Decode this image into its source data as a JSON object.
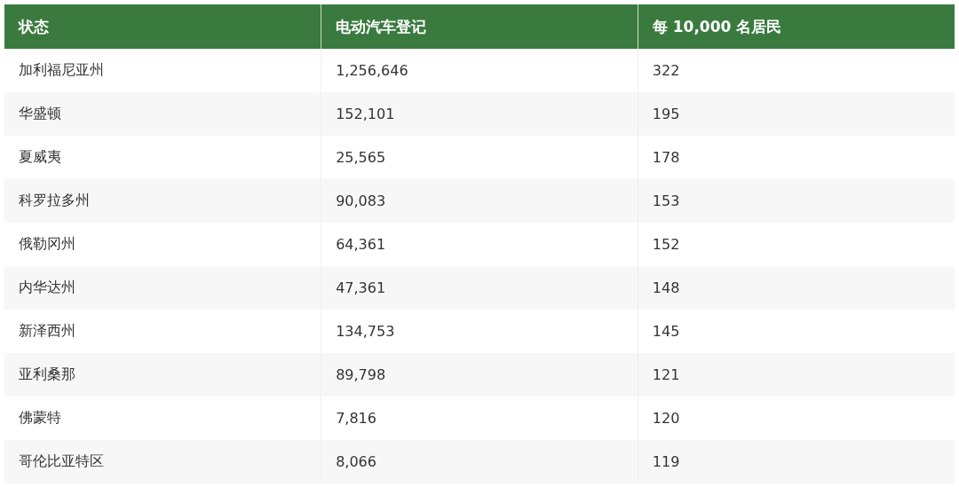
{
  "table": {
    "columns": [
      "状态",
      "电动汽车登记",
      "每 10,000 名居民"
    ],
    "rows": [
      [
        "加利福尼亚州",
        "1,256,646",
        "322"
      ],
      [
        "华盛顿",
        "152,101",
        "195"
      ],
      [
        "夏威夷",
        "25,565",
        "178"
      ],
      [
        "科罗拉多州",
        "90,083",
        "153"
      ],
      [
        "俄勒冈州",
        "64,361",
        "152"
      ],
      [
        "内华达州",
        "47,361",
        "148"
      ],
      [
        "新泽西州",
        "134,753",
        "145"
      ],
      [
        "亚利桑那",
        "89,798",
        "121"
      ],
      [
        "佛蒙特",
        "7,816",
        "120"
      ],
      [
        "哥伦比亚特区",
        "8,066",
        "119"
      ]
    ]
  }
}
